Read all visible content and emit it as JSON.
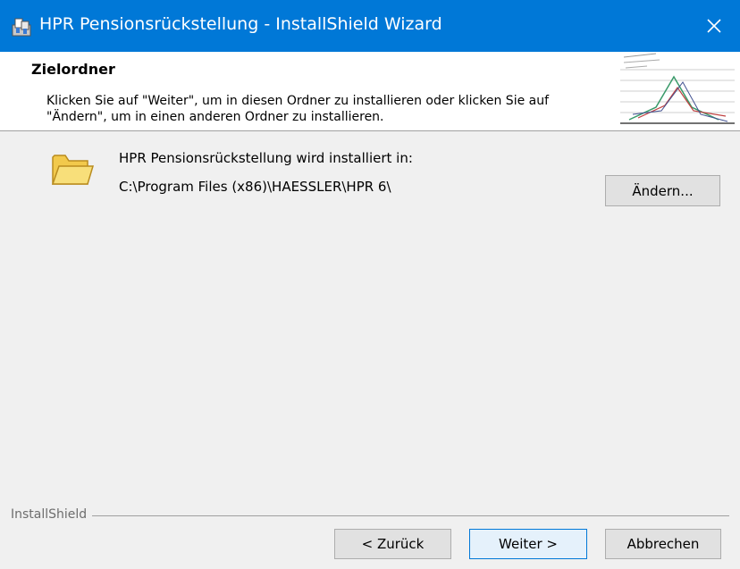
{
  "window": {
    "title": "HPR Pensionsrückstellung - InstallShield Wizard",
    "icon": "installer-icon",
    "close_icon": "close-icon"
  },
  "header": {
    "title": "Zielordner",
    "description_line1": "Klicken Sie auf \"Weiter\", um in diesen Ordner zu installieren oder klicken Sie auf",
    "description_line2": "\"Ändern\", um in einen anderen Ordner zu installieren."
  },
  "main": {
    "install_label": "HPR Pensionsrückstellung wird installiert in:",
    "install_path": "C:\\Program Files (x86)\\HAESSLER\\HPR 6\\",
    "change_button": "Ändern..."
  },
  "footer": {
    "brand": "InstallShield",
    "back_button": "< Zurück",
    "next_button": "Weiter >",
    "cancel_button": "Abbrechen"
  },
  "colors": {
    "titlebar": "#0078d7",
    "dialog_background": "#f0f0f0",
    "header_background": "#ffffff",
    "default_button_border": "#0078d7"
  }
}
